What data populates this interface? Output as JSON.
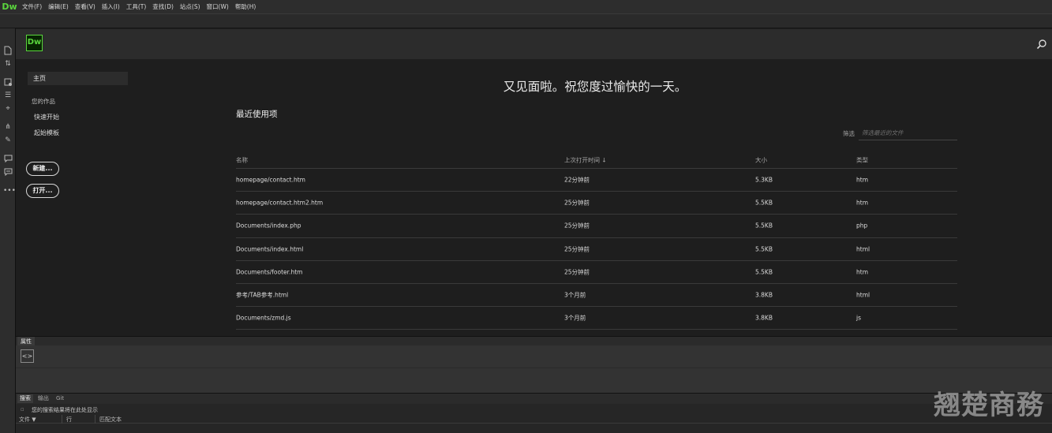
{
  "app": {
    "logo": "Dw",
    "menu": [
      "文件(F)",
      "编辑(E)",
      "查看(V)",
      "插入(I)",
      "工具(T)",
      "查找(D)",
      "站点(S)",
      "窗口(W)",
      "帮助(H)"
    ]
  },
  "iconbar": {
    "icons": [
      "new-document-icon",
      "file-transfer-icon",
      "inspect-icon",
      "code-navigator-icon",
      "live-view-icon",
      "dom-icon",
      "brush-icon",
      "comment-icon",
      "snippet-icon",
      "more-icon"
    ]
  },
  "start": {
    "logo": "Dw",
    "sidebar": {
      "home": "主页",
      "your_work": "您的作品",
      "quick_start": "快速开始",
      "starter_templates": "起始模板",
      "new_button": "新建...",
      "open_button": "打开..."
    },
    "greeting": "又见面啦。祝您度过愉快的一天。",
    "recent_title": "最近使用项",
    "filter_label": "筛选",
    "filter_placeholder": "筛选最近的文件",
    "columns": {
      "name": "名称",
      "last_opened": "上次打开时间 ↓",
      "size": "大小",
      "type": "类型"
    },
    "files": [
      {
        "name": "homepage/contact.htm",
        "time": "22分钟前",
        "size": "5.3KB",
        "type": "htm"
      },
      {
        "name": "homepage/contact.htm2.htm",
        "time": "25分钟前",
        "size": "5.5KB",
        "type": "htm"
      },
      {
        "name": "Documents/index.php",
        "time": "25分钟前",
        "size": "5.5KB",
        "type": "php"
      },
      {
        "name": "Documents/index.html",
        "time": "25分钟前",
        "size": "5.5KB",
        "type": "html"
      },
      {
        "name": "Documents/footer.htm",
        "time": "25分钟前",
        "size": "5.5KB",
        "type": "htm"
      },
      {
        "name": "参考/TAB参考.html",
        "time": "3个月前",
        "size": "3.8KB",
        "type": "html"
      },
      {
        "name": "Documents/zmd.js",
        "time": "3个月前",
        "size": "3.8KB",
        "type": "js"
      }
    ]
  },
  "properties": {
    "tab": "属性",
    "html_icon": "<>"
  },
  "bottom_panel": {
    "tabs": [
      "搜索",
      "输出",
      "Git"
    ],
    "message": "您的搜索结果将在此处显示",
    "columns": [
      "文件 ▼",
      "行",
      "匹配文本"
    ]
  },
  "watermark": "翘楚商務",
  "colors": {
    "brand_green": "#5ad53d",
    "background": "#1e1e1e",
    "header": "#2c2c2c"
  }
}
